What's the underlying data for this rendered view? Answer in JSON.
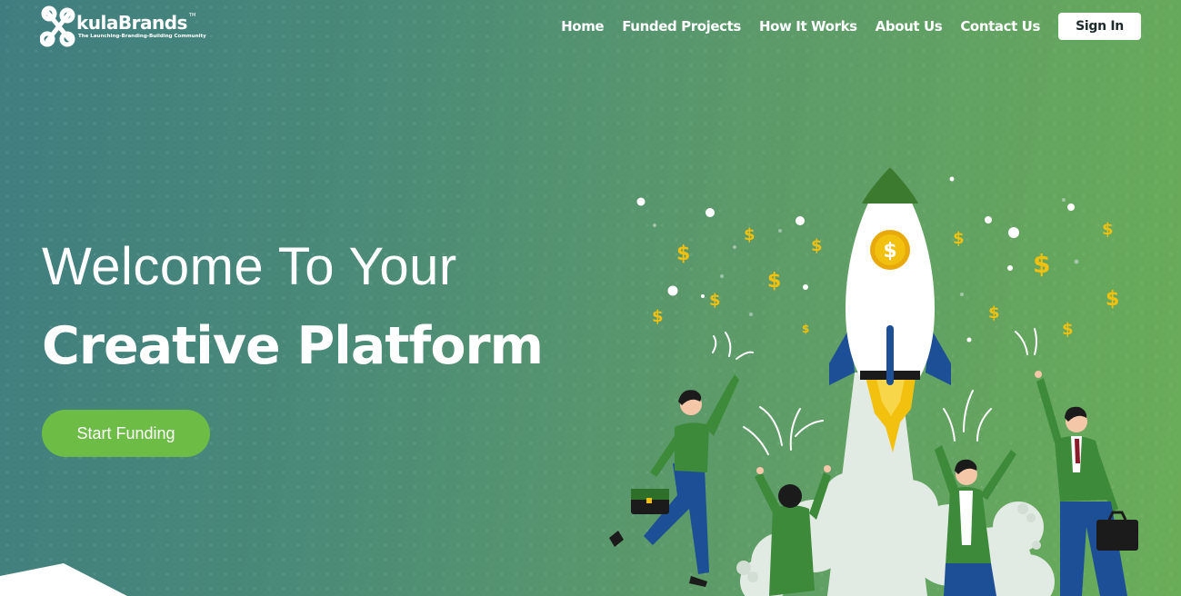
{
  "brand": {
    "name": "kulaBrands",
    "trademark": "TM",
    "tagline": "The Launching-Branding-Building Community"
  },
  "nav": {
    "links": [
      "Home",
      "Funded Projects",
      "How It Works",
      "About Us",
      "Contact Us"
    ],
    "signin_label": "Sign In"
  },
  "hero": {
    "line1": "Welcome To Your",
    "line2": "Creative Platform",
    "cta_label": "Start Funding"
  },
  "illustration": {
    "coin_symbol": "$",
    "dollar_symbol": "$"
  },
  "colors": {
    "accent_green": "#6cbc45",
    "gold": "#f2c00f",
    "rocket_blue": "#1d4f97"
  }
}
